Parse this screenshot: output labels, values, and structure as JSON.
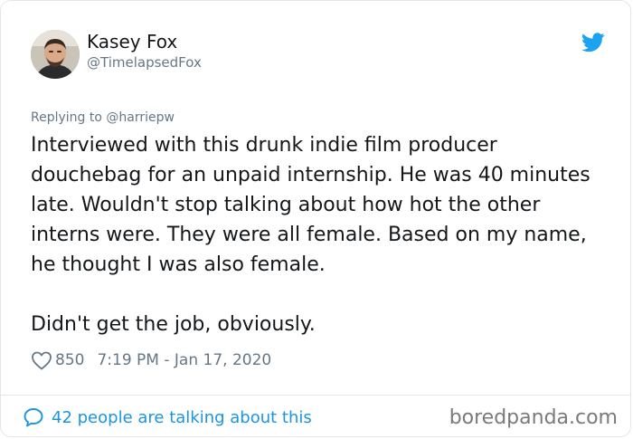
{
  "author": {
    "display_name": "Kasey Fox",
    "handle": "@TimelapsedFox"
  },
  "reply": {
    "prefix": "Replying to",
    "mention": "@harriepw"
  },
  "tweet": {
    "paragraph_1": "Interviewed with this drunk indie film producer douchebag for an unpaid internship. He was 40 minutes late. Wouldn't stop talking about how hot the other interns were. They were all female. Based on my name, he thought I was also female.",
    "paragraph_2": "Didn't get the job, obviously."
  },
  "meta": {
    "likes": "850",
    "timestamp": "7:19 PM - Jan 17, 2020"
  },
  "footer": {
    "talking": "42 people are talking about this",
    "watermark": "boredpanda.com"
  },
  "icons": {
    "brand": "twitter-bird-icon",
    "like": "heart-icon",
    "conversation": "speech-bubble-icon"
  },
  "colors": {
    "twitter_blue": "#1da1f2",
    "link_blue": "#1b95e0",
    "secondary_text": "#657786",
    "primary_text": "#14171a",
    "border": "#e1e8ed"
  }
}
